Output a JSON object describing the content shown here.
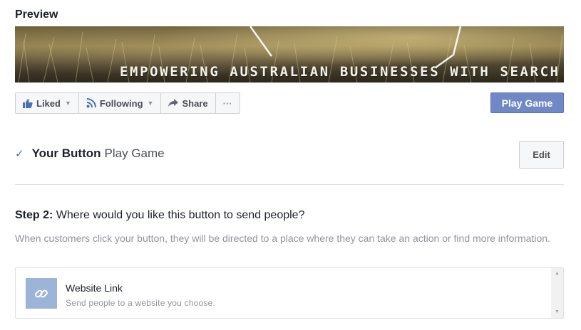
{
  "preview": {
    "title": "Preview",
    "cover_text": "EMPOWERING AUSTRALIAN BUSINESSES WITH SEARCH MARKETING"
  },
  "actions": {
    "liked_label": "Liked",
    "following_label": "Following",
    "share_label": "Share",
    "more_label": "···"
  },
  "cta": {
    "label": "Play Game",
    "color": "#7089c6"
  },
  "your_button": {
    "label": "Your Button",
    "value": "Play Game",
    "edit_label": "Edit"
  },
  "step2": {
    "prefix": "Step 2:",
    "question": "Where would you like this button to send people?",
    "description": "When customers click your button, they will be directed to a place where they can take an action or find more information."
  },
  "options": [
    {
      "icon": "link-icon",
      "title": "Website Link",
      "subtitle": "Send people to a website you choose."
    }
  ]
}
